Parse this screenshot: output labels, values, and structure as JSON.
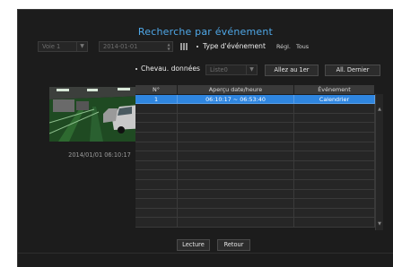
{
  "title": "Recherche par événement",
  "filters": {
    "channel": "Voie 1",
    "date": "2014-01-01",
    "event_type_label": "Type d'événement",
    "settings_label": "Régl.",
    "event_type_value": "Tous"
  },
  "overlap": {
    "label": "Chevau. données",
    "value": "Liste0",
    "go_first_label": "Allez au 1er",
    "go_last_label": "All. Dernier"
  },
  "preview": {
    "timestamp": "2014/01/01 06:10:17"
  },
  "table": {
    "headers": [
      "N°",
      "Aperçu date/heure",
      "Événement"
    ],
    "rows": [
      {
        "no": "1",
        "datetime": "06:10:17 ~ 06:53:40",
        "event": "Calendrier"
      }
    ]
  },
  "footer": {
    "play_label": "Lecture",
    "back_label": "Retour"
  },
  "colors": {
    "accent": "#4fa8e8",
    "selection": "#2f86e0",
    "background": "#1c1c1c"
  },
  "icons": [
    "calendar-icon",
    "dropdown-arrow-icon",
    "scroll-up-icon",
    "scroll-down-icon"
  ]
}
